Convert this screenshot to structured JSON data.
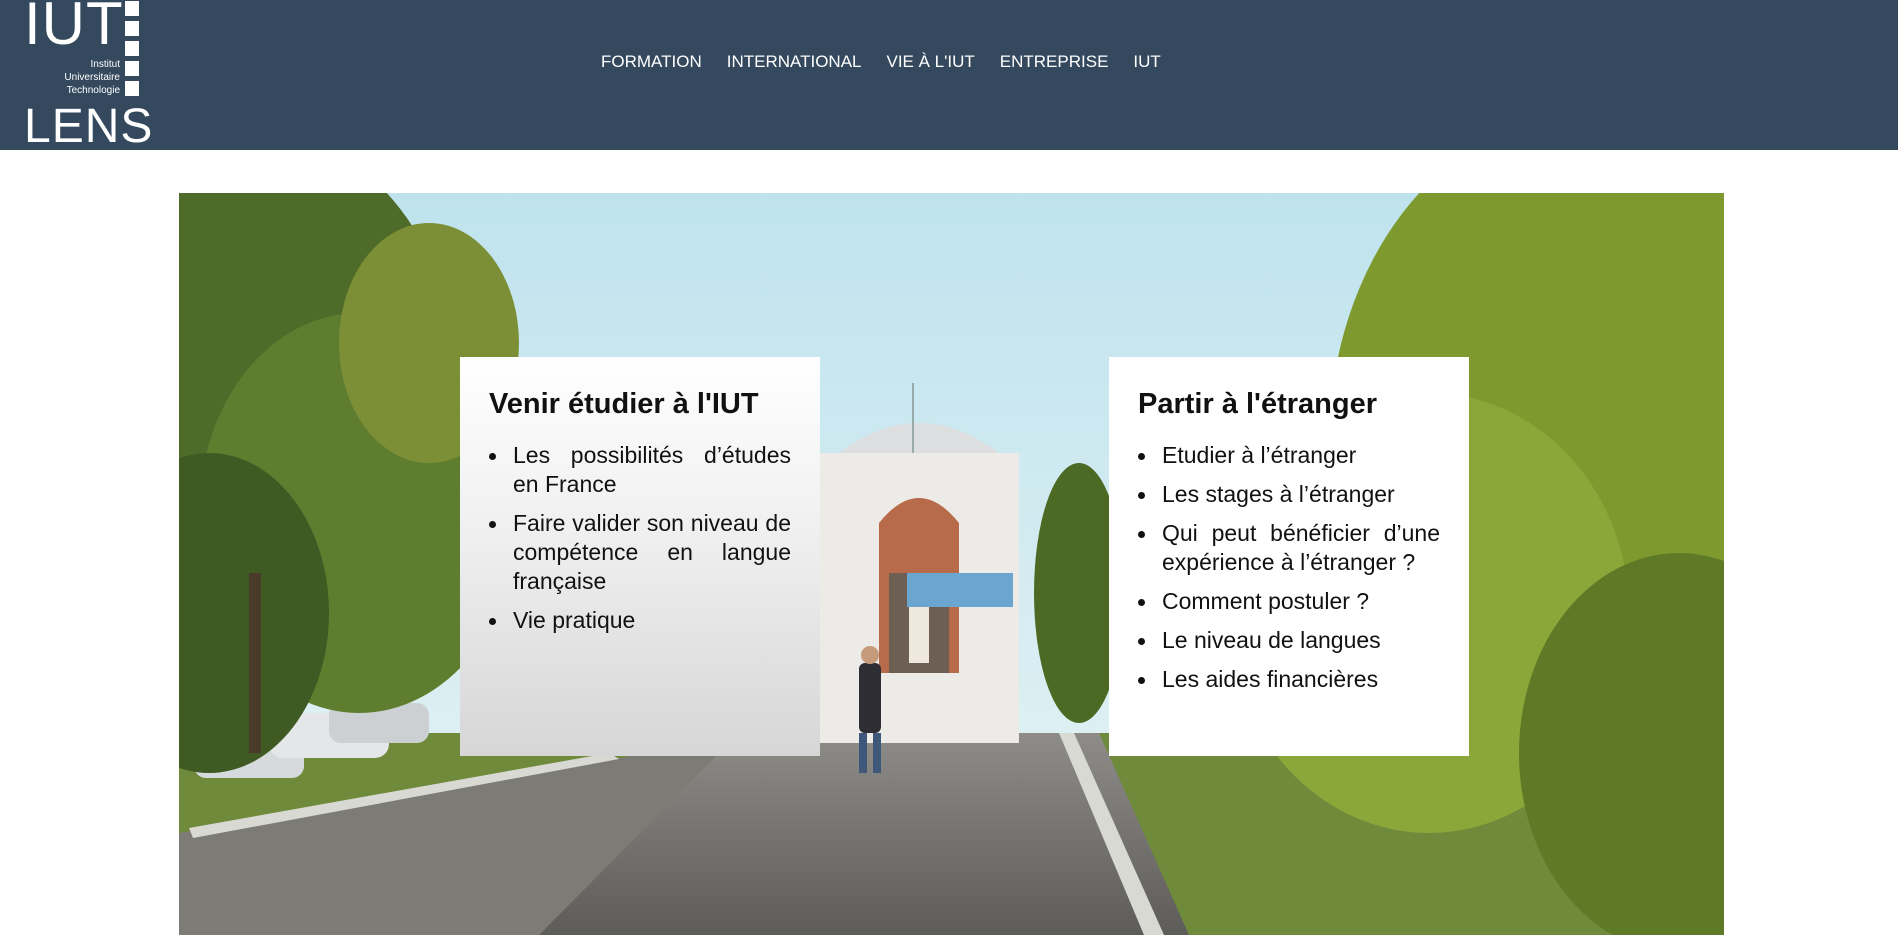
{
  "logo": {
    "top": "IUT",
    "sub_lines": [
      "Institut",
      "Universitaire",
      "Technologie"
    ],
    "bottom": "LENS"
  },
  "nav": {
    "items": [
      {
        "label": "FORMATION"
      },
      {
        "label": "INTERNATIONAL"
      },
      {
        "label": "VIE À L'IUT"
      },
      {
        "label": "ENTREPRISE"
      },
      {
        "label": "IUT"
      }
    ]
  },
  "hero": {
    "left_card": {
      "title": "Venir étudier à l'IUT",
      "items": [
        "Les possibilités d’études en France",
        "Faire valider son niveau de compétence en langue française",
        "Vie pratique"
      ]
    },
    "right_card": {
      "title": "Partir à l'étranger",
      "items": [
        "Etudier à l’étranger",
        "Les stages à l’étranger",
        "Qui peut bénéficier d’une expérience à l’étranger ?",
        "Comment postuler ?",
        "Le niveau de langues",
        "Les aides financières"
      ]
    }
  },
  "colors": {
    "header_bg": "#34495e",
    "text_dark": "#111111"
  }
}
